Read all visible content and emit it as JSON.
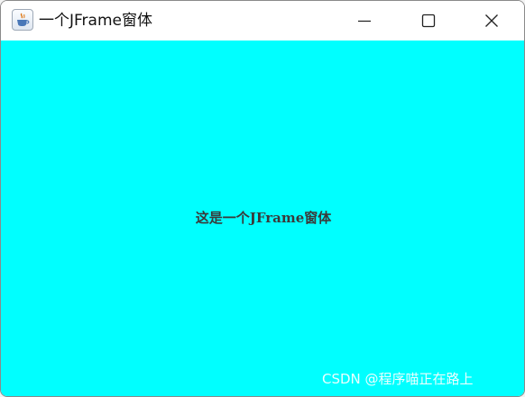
{
  "window": {
    "title": "一个JFrame窗体",
    "app_icon": "java-coffee-cup-icon",
    "controls": {
      "minimize_icon": "minimize-icon",
      "maximize_icon": "maximize-icon",
      "close_icon": "close-icon"
    }
  },
  "content": {
    "background_color": "#00ffff",
    "label": "这是一个JFrame窗体"
  },
  "watermark": {
    "text": "CSDN @程序喵正在路上"
  }
}
